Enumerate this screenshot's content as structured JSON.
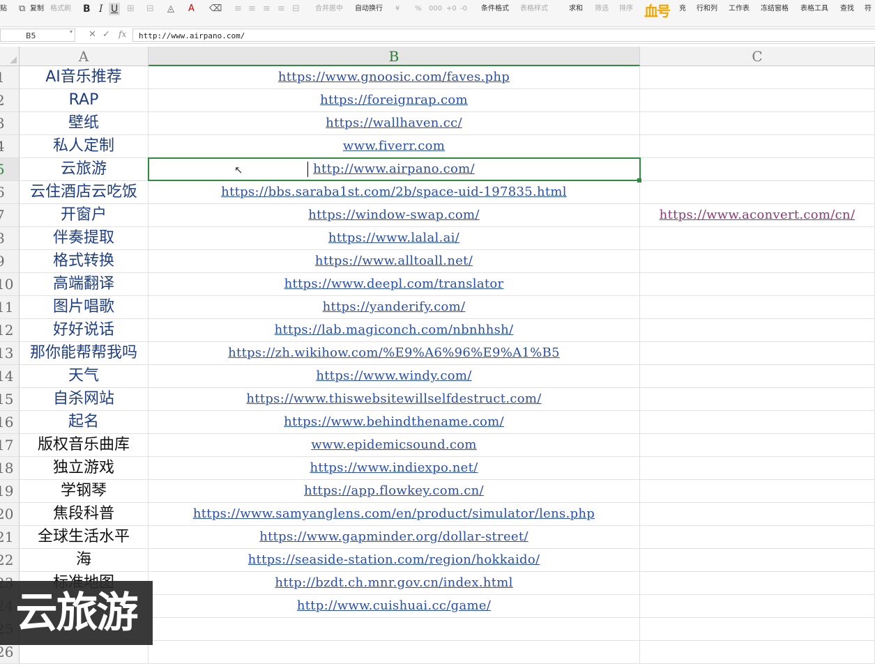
{
  "ribbon": {
    "paste": "贴",
    "copy": "复制",
    "format_painter": "格式刷",
    "bold": "B",
    "italic": "I",
    "underline": "U",
    "merge_center": "合并居中",
    "wrap_text": "自动换行",
    "currency": "¥",
    "percent": "%",
    "thousands": "000",
    "dec_increase": "+0",
    "dec_decrease": "-0",
    "conditional_format": "条件格式",
    "table_style": "表格样式",
    "sum": "求和",
    "filter": "筛选",
    "sort": "排序",
    "fill": "充",
    "rows_cols": "行和列",
    "worksheet": "工作表",
    "freeze": "冻结窗格",
    "table_tools": "表格工具",
    "find": "查找",
    "more": "符",
    "brand_watermark": "血号"
  },
  "formula_bar": {
    "name_box": "B5",
    "fx": "fx",
    "value": "http://www.airpano.com/"
  },
  "columns": [
    "A",
    "B",
    "C"
  ],
  "rows": [
    {
      "n": "1",
      "a": "AI音乐推荐",
      "b": "https://www.gnoosic.com/faves.php",
      "c": ""
    },
    {
      "n": "2",
      "a": "RAP",
      "b": "https://foreignrap.com",
      "c": ""
    },
    {
      "n": "3",
      "a": "壁纸",
      "b": "https://wallhaven.cc/",
      "c": ""
    },
    {
      "n": "4",
      "a": "私人定制",
      "b": "www.fiverr.com",
      "c": ""
    },
    {
      "n": "5",
      "a": "云旅游",
      "b": "http://www.airpano.com/",
      "c": ""
    },
    {
      "n": "6",
      "a": "云住酒店云吃饭",
      "b": "https://bbs.saraba1st.com/2b/space-uid-197835.html",
      "c": ""
    },
    {
      "n": "7",
      "a": "开窗户",
      "b": "https://window-swap.com/",
      "c": "https://www.aconvert.com/cn/"
    },
    {
      "n": "8",
      "a": "伴奏提取",
      "b": "https://www.lalal.ai/",
      "c": ""
    },
    {
      "n": "9",
      "a": "格式转换",
      "b": "https://www.alltoall.net/",
      "c": ""
    },
    {
      "n": "10",
      "a": "高端翻译",
      "b": "https://www.deepl.com/translator",
      "c": ""
    },
    {
      "n": "11",
      "a": "图片唱歌",
      "b": "https://yanderify.com/",
      "c": ""
    },
    {
      "n": "12",
      "a": "好好说话",
      "b": "https://lab.magiconch.com/nbnhhsh/",
      "c": ""
    },
    {
      "n": "13",
      "a": "那你能帮帮我吗",
      "b": "https://zh.wikihow.com/%E9%A6%96%E9%A1%B5",
      "c": ""
    },
    {
      "n": "14",
      "a": "天气",
      "b": "https://www.windy.com/",
      "c": ""
    },
    {
      "n": "15",
      "a": "自杀网站",
      "b": "https://www.thiswebsitewillselfdestruct.com/",
      "c": ""
    },
    {
      "n": "16",
      "a": "起名",
      "b": "https://www.behindthename.com/",
      "c": ""
    },
    {
      "n": "17",
      "a": "版权音乐曲库",
      "b": "www.epidemicsound.com",
      "c": ""
    },
    {
      "n": "18",
      "a": "独立游戏",
      "b": "https://www.indiexpo.net/",
      "c": ""
    },
    {
      "n": "19",
      "a": "学钢琴",
      "b": "https://app.flowkey.com.cn/",
      "c": ""
    },
    {
      "n": "20",
      "a": "焦段科普",
      "b": "https://www.samyanglens.com/en/product/simulator/lens.php",
      "c": ""
    },
    {
      "n": "21",
      "a": "全球生活水平",
      "b": "https://www.gapminder.org/dollar-street/",
      "c": ""
    },
    {
      "n": "22",
      "a": "海",
      "b": "https://seaside-station.com/region/hokkaido/",
      "c": ""
    },
    {
      "n": "23",
      "a": "标准地图",
      "b": "http://bzdt.ch.mnr.gov.cn/index.html",
      "c": ""
    },
    {
      "n": "24",
      "a": "",
      "b": "http://www.cuishuai.cc/game/",
      "c": ""
    },
    {
      "n": "25",
      "a": "",
      "b": "",
      "c": ""
    },
    {
      "n": "26",
      "a": "",
      "b": "",
      "c": ""
    }
  ],
  "dark_text_rows": [
    "17",
    "18",
    "19",
    "20",
    "21",
    "22",
    "23"
  ],
  "active_row": "5",
  "active_column": "B",
  "overlay_caption": "云旅游",
  "colors": {
    "selection_green": "#2d8a3e",
    "link_blue": "#2a4fa6",
    "visited_link": "#8b3a7a",
    "label_blue": "#1f3f82"
  }
}
